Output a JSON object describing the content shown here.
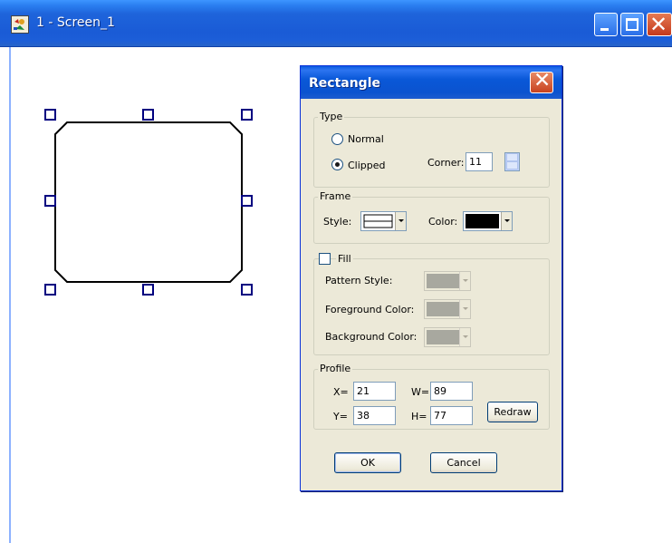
{
  "window": {
    "title": "1 - Screen_1",
    "icon": "app-icon",
    "controls": [
      "minimize",
      "maximize",
      "close"
    ]
  },
  "canvas": {
    "shape": "clipped-rectangle",
    "selection_handles": 8
  },
  "dialog": {
    "title": "Rectangle",
    "type_group": {
      "label": "Type",
      "normal_label": "Normal",
      "clipped_label": "Clipped",
      "selected": "Clipped",
      "corner_label": "Corner:",
      "corner_value": "11"
    },
    "frame_group": {
      "label": "Frame",
      "style_label": "Style:",
      "color_label": "Color:",
      "color_value": "#000000"
    },
    "fill_group": {
      "label": "Fill",
      "checked": false,
      "pattern_style_label": "Pattern Style:",
      "foreground_color_label": "Foreground Color:",
      "background_color_label": "Background Color:"
    },
    "profile_group": {
      "label": "Profile",
      "x_label": "X=",
      "x_value": "21",
      "y_label": "Y=",
      "y_value": "38",
      "w_label": "W=",
      "w_value": "89",
      "h_label": "H=",
      "h_value": "77",
      "redraw_label": "Redraw"
    },
    "ok_label": "OK",
    "cancel_label": "Cancel"
  },
  "colors": {
    "titlebar": "#1a5bd6",
    "dialog_bg": "#ece9d8",
    "handle": "#000080"
  }
}
